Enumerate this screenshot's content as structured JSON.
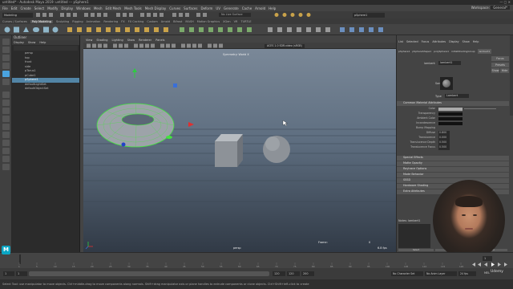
{
  "window": {
    "title": "untitled* - Autodesk Maya 2019: untitled  ---  pSphere1"
  },
  "menubar": {
    "items": [
      "File",
      "Edit",
      "Create",
      "Select",
      "Modify",
      "Display",
      "Windows",
      "Mesh",
      "Edit Mesh",
      "Mesh Tools",
      "Mesh Display",
      "Curves",
      "Surfaces",
      "Deform",
      "UV",
      "Generate",
      "Cache",
      "Arnold",
      "Help"
    ],
    "workspace_label": "Workspace:",
    "workspace_value": "General*"
  },
  "statusline": {
    "mode": "Modeling",
    "no_live_surface": "No Live Surface",
    "object_field": "pSphere1"
  },
  "shelf": {
    "tabs": [
      "Curves / Surfaces",
      "Poly Modeling",
      "Sculpting",
      "Rigging",
      "Animation",
      "Rendering",
      "FX",
      "FX Caching",
      "Custom",
      "Arnold",
      "Bifrost",
      "MASH",
      "Motion Graphics",
      "XGen",
      "VR",
      "TURTLE"
    ]
  },
  "outliner": {
    "title": "Outliner",
    "menu": [
      "Display",
      "Show",
      "Help"
    ],
    "items": [
      "persp",
      "top",
      "front",
      "side",
      "pTorus1",
      "pCube1",
      "pSphere1",
      "defaultLightSet",
      "defaultObjectSet"
    ],
    "selected_index": 6
  },
  "viewport": {
    "menu": [
      "View",
      "Shading",
      "Lighting",
      "Show",
      "Renderer",
      "Panels"
    ],
    "hud_top": "Symmetry: World X",
    "camera_label": "persp",
    "frame_label": "Frame:",
    "frame_value": "0",
    "fps": "6.8 fps",
    "colorspace": "ACES 1.0 SDR-video (sRGB)"
  },
  "attribute_editor": {
    "menu": [
      "List",
      "Selected",
      "Focus",
      "Attributes",
      "Display",
      "Show",
      "Help"
    ],
    "tabs": [
      "pSphere1",
      "pSphereShape1",
      "polySphere1",
      "initialShadingGroup",
      "lambert1"
    ],
    "node_label": "lambert:",
    "node_value": "lambert1",
    "focus_btn": "Focus",
    "presets_btn": "Presets",
    "show_btn": "Show",
    "hide_btn": "Hide",
    "sample_label": "Sample",
    "type_label": "Type",
    "type_value": "Lambert",
    "sections": [
      "Common Material Attributes",
      "Special Effects",
      "Matte Opacity",
      "Raytrace Options",
      "Mode Behavior",
      "SSSD",
      "Hardware Shading",
      "Extra Attributes"
    ],
    "attributes": [
      {
        "label": "Color",
        "value": ""
      },
      {
        "label": "Transparency",
        "value": ""
      },
      {
        "label": "Ambient Color",
        "value": ""
      },
      {
        "label": "Incandescence",
        "value": ""
      },
      {
        "label": "Bump Mapping",
        "value": ""
      },
      {
        "label": "Diffuse",
        "value": "0.800"
      },
      {
        "label": "Translucence",
        "value": "0.000"
      },
      {
        "label": "Translucence Depth",
        "value": "0.500"
      },
      {
        "label": "Translucence Focus",
        "value": "0.500"
      }
    ],
    "notes_label": "Notes:",
    "notes_value": "lambert1",
    "select_btn": "Select",
    "load_btn": "Load Attributes",
    "copy_btn": "Copy Tab"
  },
  "timeline": {
    "ticks": [
      "1",
      "5",
      "10",
      "15",
      "20",
      "25",
      "30",
      "35",
      "40",
      "45",
      "50",
      "55",
      "60",
      "65",
      "70",
      "75",
      "80",
      "85",
      "90",
      "95",
      "100",
      "105",
      "110",
      "115",
      "120"
    ],
    "current_frame": "1"
  },
  "range": {
    "start": "1",
    "start2": "1",
    "end": "120",
    "end2": "120",
    "end3": "200",
    "character_set": "No Character Set",
    "anim_layer": "No Anim Layer",
    "fps": "24 fps"
  },
  "mel": {
    "label": "MEL"
  },
  "helpline": {
    "text": "Select Tool: use manipulator to move objects. Ctrl+middle-drag to move components along normals. Shift+drag manipulator axis or plane handles to extrude components or clone objects. Ctrl+Shift+left-click to create"
  },
  "watermark": "Udemy",
  "colors": {
    "selection": "#5285a6",
    "wireframe": "#43e43e",
    "accent_blue": "#4aa3df"
  }
}
